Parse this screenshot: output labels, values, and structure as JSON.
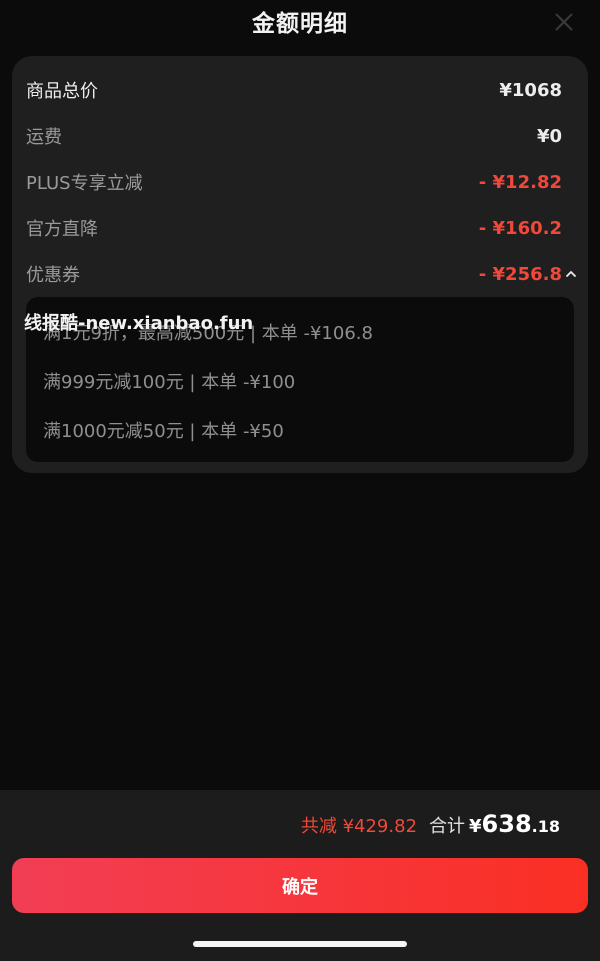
{
  "header": {
    "title": "金额明细",
    "close_icon": "close-icon"
  },
  "breakdown": {
    "rows": [
      {
        "label": "商品总价",
        "value": "¥1068"
      },
      {
        "label": "运费",
        "value": "¥0"
      },
      {
        "label": "PLUS专享立减",
        "value": "- ¥12.82"
      },
      {
        "label": "官方直降",
        "value": "- ¥160.2"
      },
      {
        "label": "优惠券",
        "value": "- ¥256.8"
      }
    ],
    "coupon_expanded": true,
    "coupons": [
      "满1元9折，最高减500元 | 本单 -¥106.8",
      "满999元减100元 | 本单 -¥100",
      "满1000元减50元 | 本单 -¥50"
    ]
  },
  "watermark": "线报酷-new.xianbao.fun",
  "footer": {
    "total_discount": "共减 ¥429.82",
    "total_label": "合计",
    "total_currency": "¥",
    "total_integer": "638",
    "total_decimal": ".18",
    "confirm_label": "确定"
  },
  "colors": {
    "accent_red": "#f0483a",
    "button_gradient_start": "#f23e55",
    "button_gradient_end": "#fa2f24",
    "background": "#0b0b0b",
    "card": "#1f1f1f"
  }
}
